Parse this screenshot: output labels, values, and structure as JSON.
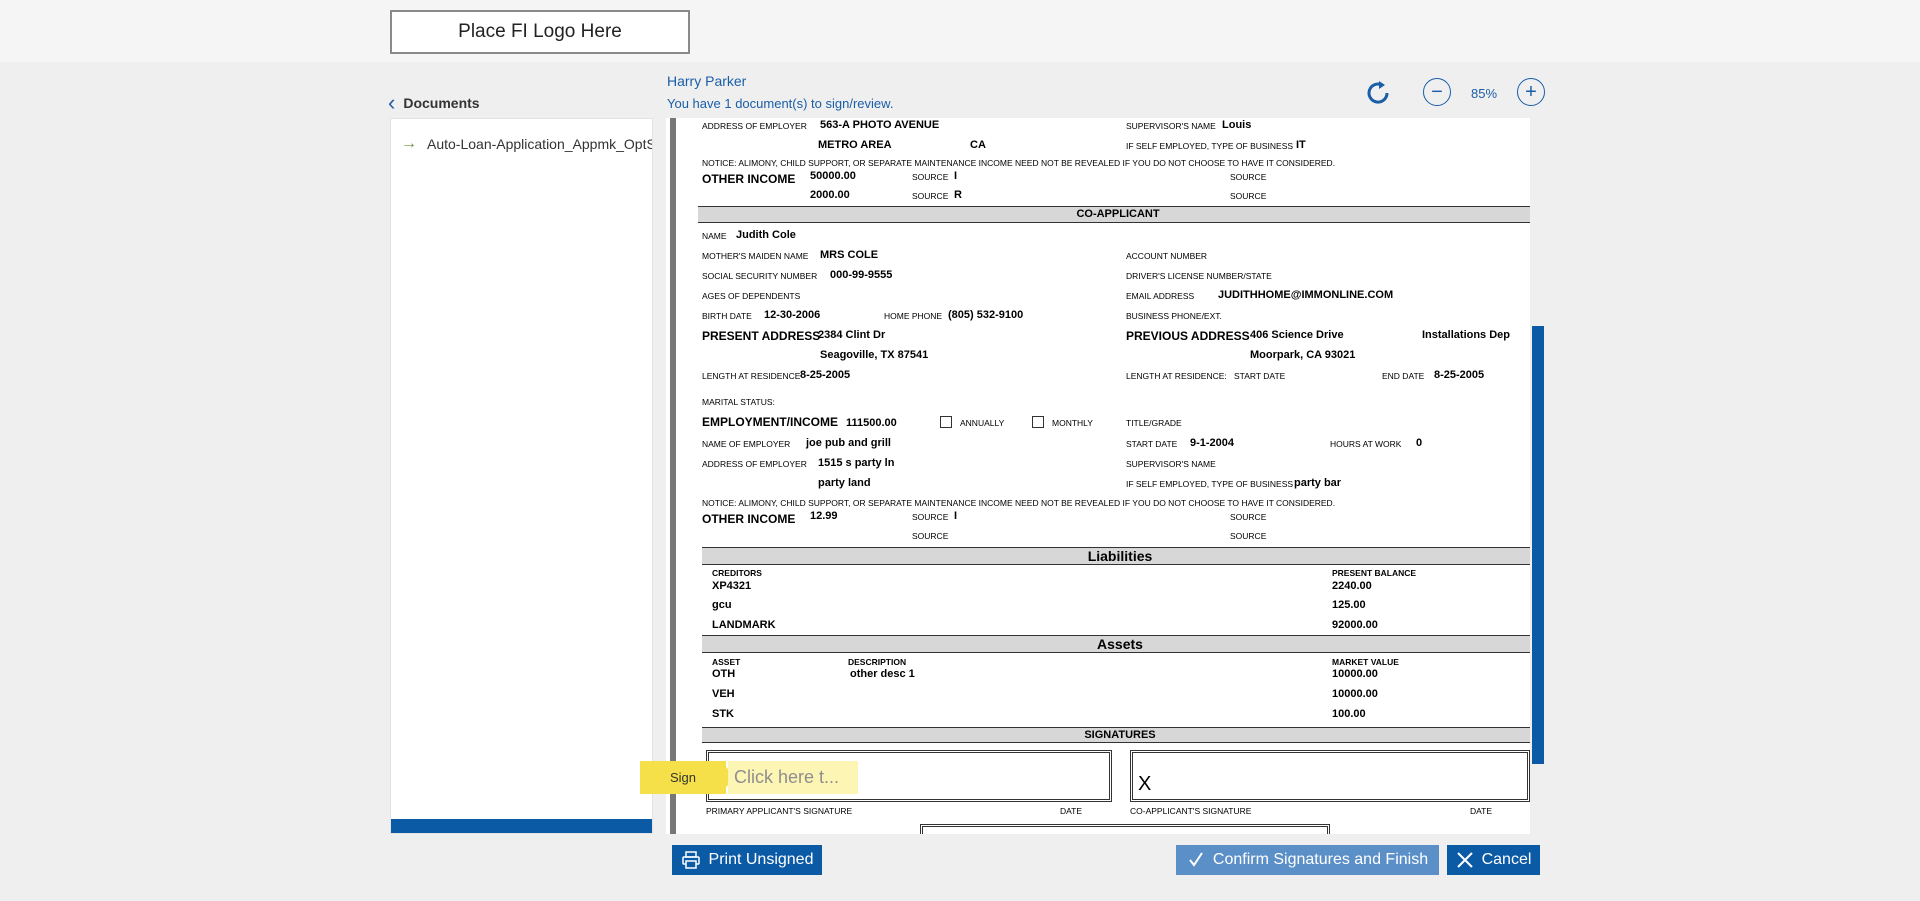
{
  "logo": {
    "text": "Place FI Logo Here"
  },
  "sidebar": {
    "title": "Documents",
    "items": [
      {
        "label": "Auto-Loan-Application_Appmk_OptS"
      }
    ]
  },
  "header": {
    "user_name": "Harry Parker",
    "message": "You have 1 document(s) to sign/review.",
    "zoom": "85%"
  },
  "document": {
    "emp1": {
      "addr_label": "ADDRESS OF EMPLOYER",
      "addr1": "563-A PHOTO AVENUE",
      "addr2": "METRO AREA",
      "addr_state": "CA",
      "supervisor_label": "SUPERVISOR'S NAME",
      "supervisor": "Louis",
      "self_emp_label": "IF SELF EMPLOYED, TYPE OF BUSINESS",
      "self_emp": "IT"
    },
    "notice": "NOTICE: ALIMONY, CHILD SUPPORT, OR SEPARATE MAINTENANCE INCOME NEED NOT BE REVEALED IF YOU DO NOT CHOOSE TO HAVE IT CONSIDERED.",
    "other_income_label": "OTHER INCOME",
    "other_income1": {
      "amount1": "50000.00",
      "amount2": "2000.00",
      "src1": "I",
      "src2": "R"
    },
    "source_label": "SOURCE",
    "coapp_title": "CO-APPLICANT",
    "coapp": {
      "name_label": "NAME",
      "name": "Judith Cole",
      "maiden_label": "MOTHER'S MAIDEN NAME",
      "maiden": "MRS COLE",
      "account_label": "ACCOUNT NUMBER",
      "ssn_label": "SOCIAL SECURITY NUMBER",
      "ssn": "000-99-9555",
      "license_label": "DRIVER'S LICENSE NUMBER/STATE",
      "ages_label": "AGES OF DEPENDENTS",
      "email_label": "EMAIL ADDRESS",
      "email": "JUDITHHOME@IMMONLINE.COM",
      "birth_label": "BIRTH DATE",
      "birth": "12-30-2006",
      "home_phone_label": "HOME PHONE",
      "home_phone": "(805) 532-9100",
      "biz_phone_label": "BUSINESS PHONE/EXT.",
      "present_label": "PRESENT ADDRESS",
      "present1": "2384 Clint Dr",
      "present2": "Seagoville, TX 87541",
      "previous_label": "PREVIOUS ADDRESS",
      "previous1": "406 Science Drive",
      "previous_extra": "Installations Dep",
      "previous2": "Moorpark, CA 93021",
      "length_label": "LENGTH AT RESIDENCE",
      "length": "8-25-2005",
      "length2_label": "LENGTH AT RESIDENCE:",
      "start_date_label": "START DATE",
      "end_date_label": "END DATE",
      "end_date": "8-25-2005",
      "marital_label": "MARITAL STATUS:",
      "employment_label": "EMPLOYMENT/INCOME",
      "employment": "111500.00",
      "annually": "ANNUALLY",
      "monthly": "MONTHLY",
      "title_label": "TITLE/GRADE",
      "employer_label": "NAME OF EMPLOYER",
      "employer": "joe pub and grill",
      "start_label": "START DATE",
      "start": "9-1-2004",
      "hours_label": "HOURS AT WORK",
      "hours": "0",
      "emp_addr_label": "ADDRESS OF EMPLOYER",
      "emp_addr1": "1515 s party ln",
      "emp_addr2": "party land",
      "supervisor_label": "SUPERVISOR'S NAME",
      "self_emp_label": "IF SELF EMPLOYED, TYPE OF BUSINESS",
      "self_emp": "party bar",
      "other_income": "12.99",
      "src1": "I"
    },
    "liabilities": {
      "title": "Liabilities",
      "creditors_label": "CREDITORS",
      "balance_label": "PRESENT BALANCE",
      "rows": [
        {
          "creditor": "XP4321",
          "balance": "2240.00"
        },
        {
          "creditor": "gcu",
          "balance": "125.00"
        },
        {
          "creditor": "LANDMARK",
          "balance": "92000.00"
        }
      ]
    },
    "assets": {
      "title": "Assets",
      "asset_label": "ASSET",
      "desc_label": "DESCRIPTION",
      "value_label": "MARKET VALUE",
      "rows": [
        {
          "asset": "OTH",
          "desc": "other desc 1",
          "value": "10000.00"
        },
        {
          "asset": "VEH",
          "desc": "",
          "value": "10000.00"
        },
        {
          "asset": "STK",
          "desc": "",
          "value": "100.00"
        }
      ]
    },
    "signatures": {
      "title": "SIGNATURES",
      "primary_label": "PRIMARY APPLICANT'S SIGNATURE",
      "co_label": "CO-APPLICANT'S SIGNATURE",
      "date_label": "DATE",
      "x_mark": "X"
    }
  },
  "sign": {
    "tag": "Sign",
    "field": "Click here t..."
  },
  "buttons": {
    "print": "Print Unsigned",
    "confirm": "Confirm Signatures and Finish",
    "cancel": "Cancel"
  },
  "colors": {
    "brand": "#0b5aa6",
    "confirm": "#5b8fc7",
    "sign_tag": "#f6e04a"
  }
}
